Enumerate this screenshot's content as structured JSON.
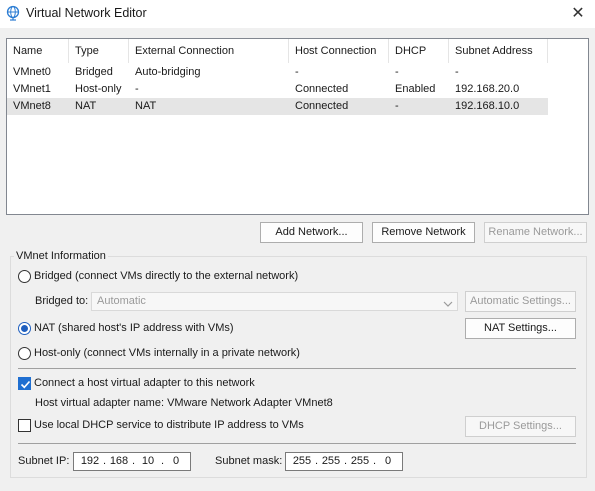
{
  "window": {
    "title": "Virtual Network Editor",
    "close_glyph": "✕"
  },
  "table": {
    "columns": [
      "Name",
      "Type",
      "External Connection",
      "Host Connection",
      "DHCP",
      "Subnet Address"
    ],
    "rows": [
      [
        "VMnet0",
        "Bridged",
        "Auto-bridging",
        "-",
        "-",
        "-"
      ],
      [
        "VMnet1",
        "Host-only",
        "-",
        "Connected",
        "Enabled",
        "192.168.20.0"
      ],
      [
        "VMnet8",
        "NAT",
        "NAT",
        "Connected",
        "-",
        "192.168.10.0"
      ]
    ],
    "selected_row": "VMnet8"
  },
  "buttons": {
    "add_network": "Add Network...",
    "remove_network": "Remove Network",
    "rename_network": "Rename Network..."
  },
  "vmnet_info": {
    "group_label": "VMnet Information",
    "bridged_label": "Bridged (connect VMs directly to the external network)",
    "bridged_to_label": "Bridged to:",
    "bridged_to_value": "Automatic",
    "automatic_settings": "Automatic Settings...",
    "nat_label": "NAT (shared host's IP address with VMs)",
    "nat_settings": "NAT Settings...",
    "hostonly_label": "Host-only (connect VMs internally in a private network)",
    "connection_type": "NAT",
    "connect_adapter_label": "Connect a host virtual adapter to this network",
    "connect_adapter_checked": true,
    "adapter_name_label": "Host virtual adapter name: VMware Network Adapter VMnet8",
    "dhcp_label": "Use local DHCP service to distribute IP address to VMs",
    "dhcp_checked": false,
    "dhcp_settings": "DHCP Settings...",
    "subnet_ip_label": "Subnet IP:",
    "subnet_ip": [
      "192",
      "168",
      "10",
      "0"
    ],
    "subnet_mask_label": "Subnet mask:",
    "subnet_mask": [
      "255",
      "255",
      "255",
      "0"
    ]
  },
  "colors": {
    "accent": "#1f6fd1",
    "selection": "#e5e5e5",
    "disabled_text": "#9a9a9a"
  },
  "icons": {
    "app": "network-globe-icon",
    "close": "close-icon",
    "dropdown": "chevron-down-icon",
    "check": "checkmark-icon"
  }
}
